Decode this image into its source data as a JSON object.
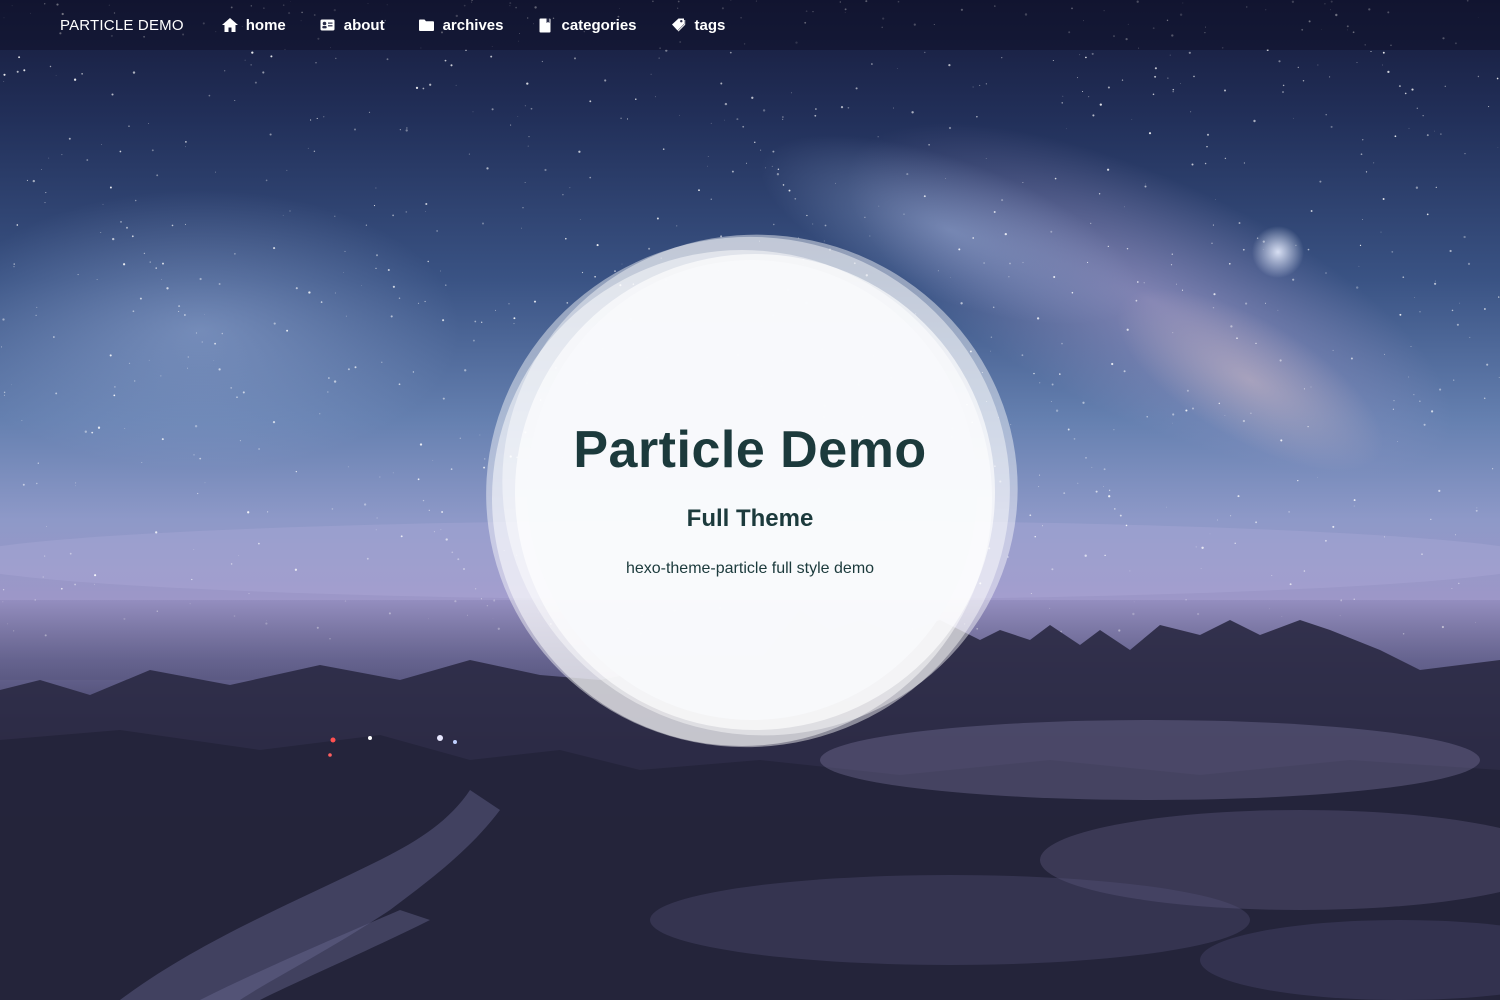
{
  "navbar": {
    "brand": "PARTICLE DEMO",
    "items": [
      {
        "label": "home",
        "icon": "home-icon"
      },
      {
        "label": "about",
        "icon": "id-card-icon"
      },
      {
        "label": "archives",
        "icon": "folder-icon"
      },
      {
        "label": "categories",
        "icon": "bookmark-icon"
      },
      {
        "label": "tags",
        "icon": "tags-icon"
      }
    ]
  },
  "hero": {
    "title": "Particle Demo",
    "subtitle": "Full Theme",
    "description": "hexo-theme-particle full style demo"
  },
  "colors": {
    "title_text": "#1c3a3c",
    "nav_text": "#ffffff",
    "navbar_bg": "rgba(14,16,40,0.55)"
  }
}
